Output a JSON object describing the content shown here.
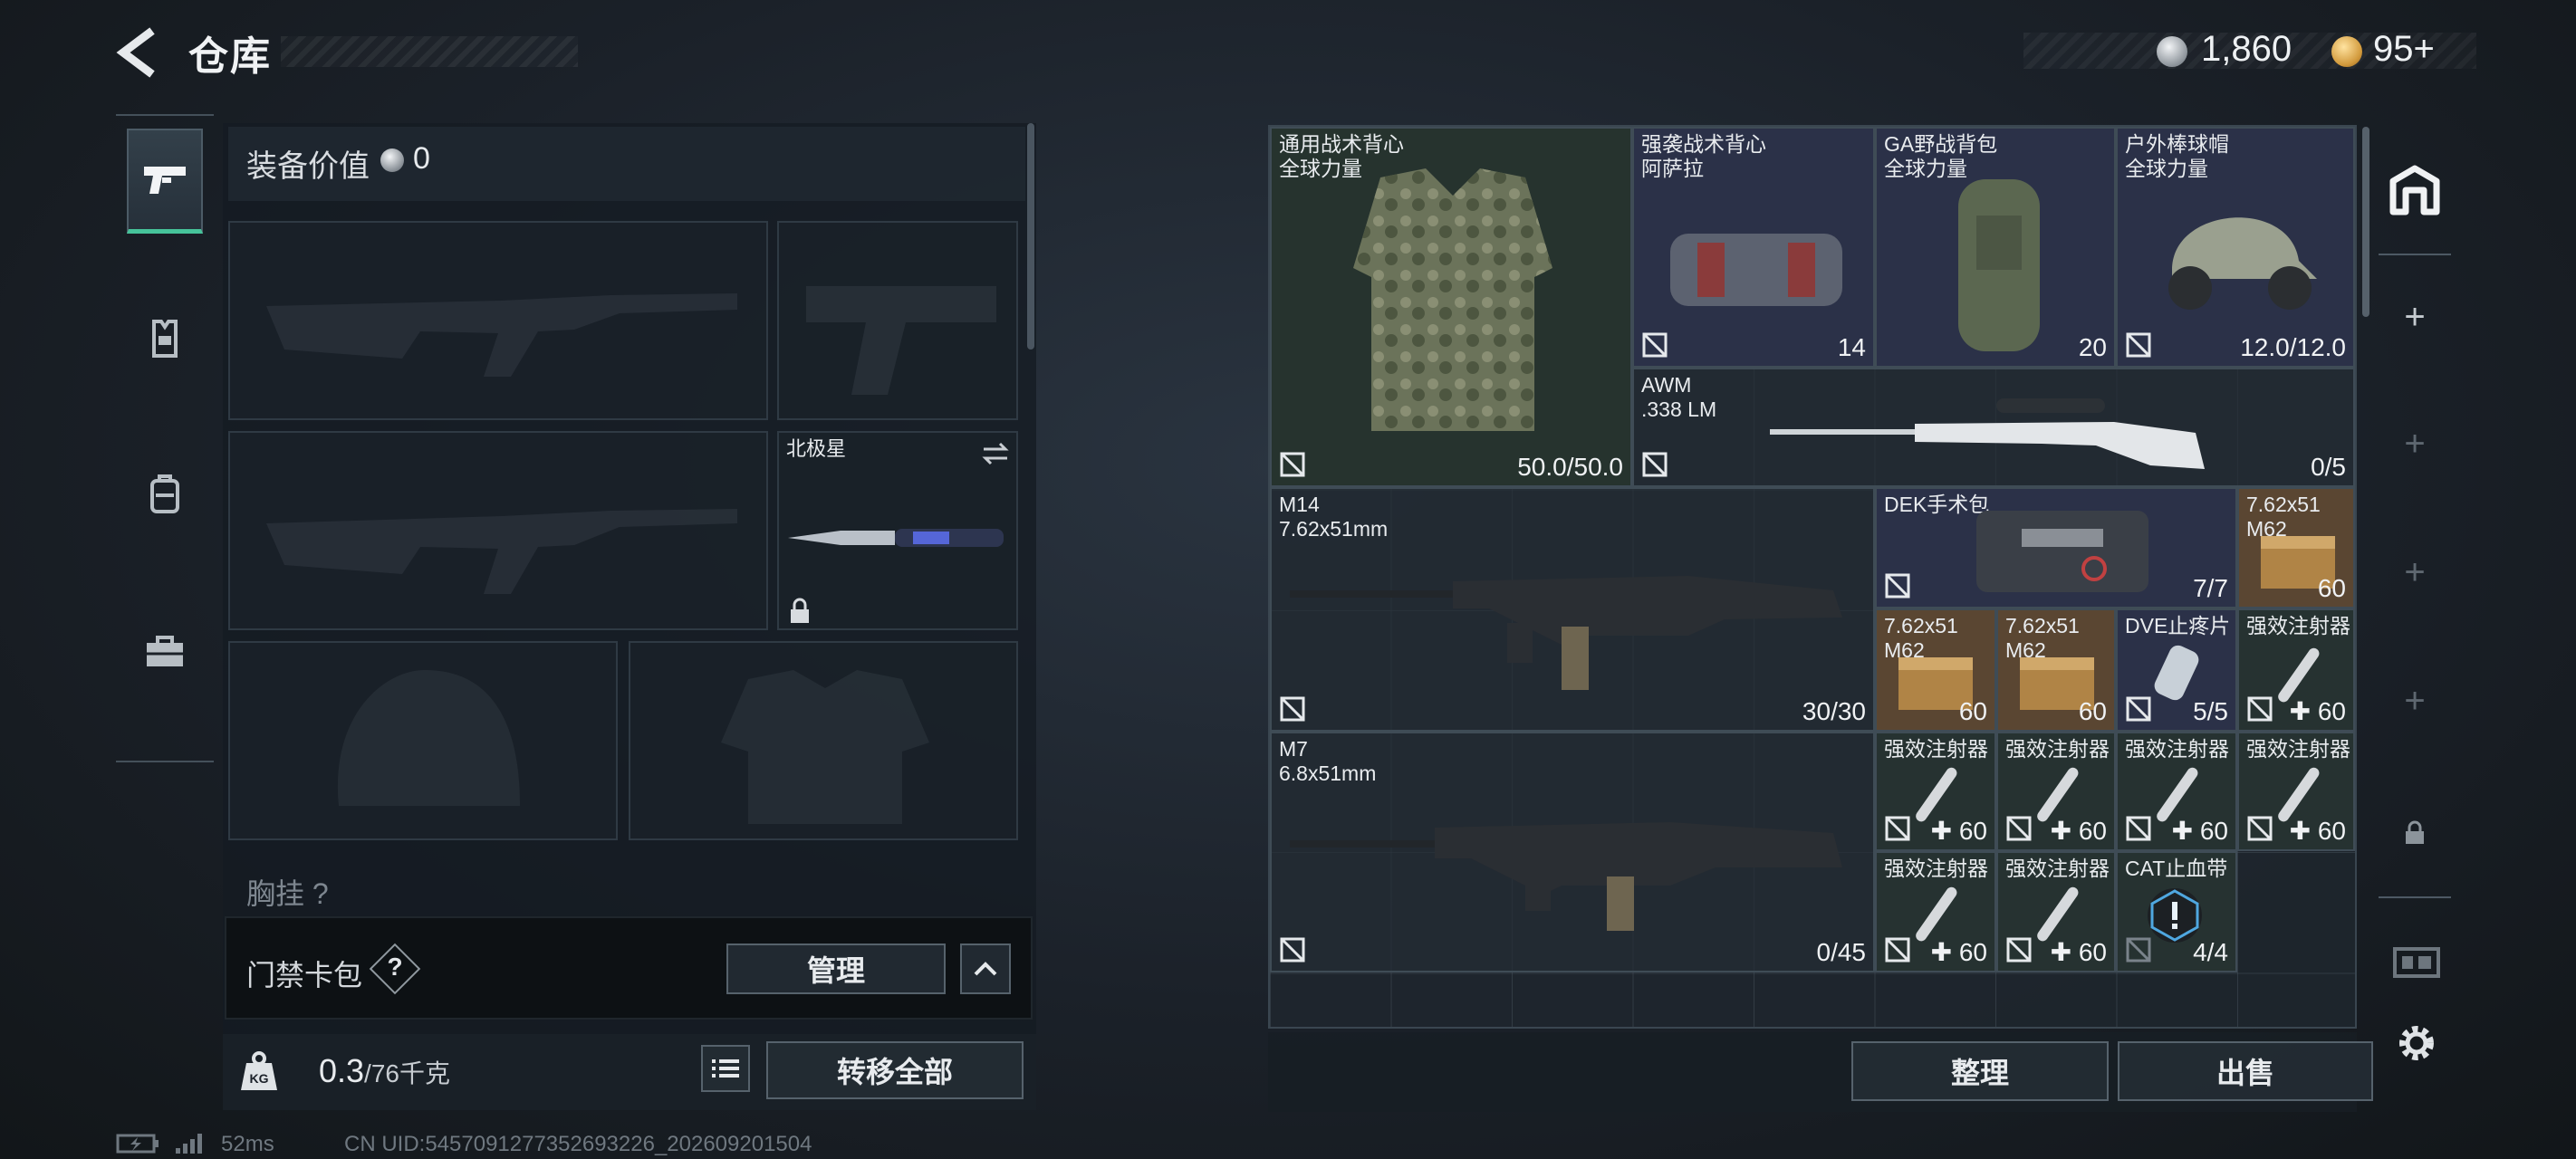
{
  "header": {
    "title": "仓库",
    "currency_silver": "1,860",
    "currency_gold": "95+"
  },
  "equipment": {
    "value_label": "装备价值",
    "value": "0",
    "melee_name": "北极星",
    "section_peek": "胸挂 ?"
  },
  "access_card": {
    "label": "门禁卡包",
    "help": "?",
    "manage_label": "管理"
  },
  "weight": {
    "current": "0.3",
    "capacity": "/76千克",
    "transfer_all_label": "转移全部"
  },
  "storage_items": [
    {
      "name": "通用战术背心",
      "sub": "全球力量",
      "count": "50.0/50.0"
    },
    {
      "name": "强袭战术背心",
      "sub": "阿萨拉",
      "count": "14"
    },
    {
      "name": "GA野战背包",
      "sub": "全球力量",
      "count": "20"
    },
    {
      "name": "户外棒球帽",
      "sub": "全球力量",
      "count": "12.0/12.0"
    },
    {
      "name": "AWM",
      "sub": ".338 LM",
      "count": "0/5"
    },
    {
      "name": "M14",
      "sub": "7.62x51mm",
      "count": "30/30"
    },
    {
      "name": "DEK手术包",
      "sub": "",
      "count": "7/7"
    },
    {
      "name": "7.62x51",
      "sub": "M62",
      "count": "60"
    },
    {
      "name": "7.62x51",
      "sub": "M62",
      "count": "60"
    },
    {
      "name": "7.62x51",
      "sub": "M62",
      "count": "60"
    },
    {
      "name": "DVE止疼片",
      "sub": "",
      "count": "5/5"
    },
    {
      "name": "强效注射器",
      "sub": "",
      "count": "60"
    },
    {
      "name": "M7",
      "sub": "6.8x51mm",
      "count": "0/45"
    },
    {
      "name": "强效注射器",
      "sub": "",
      "count": "60"
    },
    {
      "name": "强效注射器",
      "sub": "",
      "count": "60"
    },
    {
      "name": "强效注射器",
      "sub": "",
      "count": "60"
    },
    {
      "name": "强效注射器",
      "sub": "",
      "count": "60"
    },
    {
      "name": "强效注射器",
      "sub": "",
      "count": "60"
    },
    {
      "name": "强效注射器",
      "sub": "",
      "count": "60"
    },
    {
      "name": "CAT止血带",
      "sub": "",
      "count": "4/4"
    }
  ],
  "actions": {
    "sort_label": "整理",
    "sell_label": "出售"
  },
  "footer": {
    "ping": "52ms",
    "uid": "CN UID:5457091277352693226_202609201504"
  },
  "colors": {
    "accent_green": "#46c39a",
    "item_vest": "#26332e",
    "item_blue": "#2b3148",
    "item_ammo": "#5a4632",
    "item_med": "#263231"
  }
}
